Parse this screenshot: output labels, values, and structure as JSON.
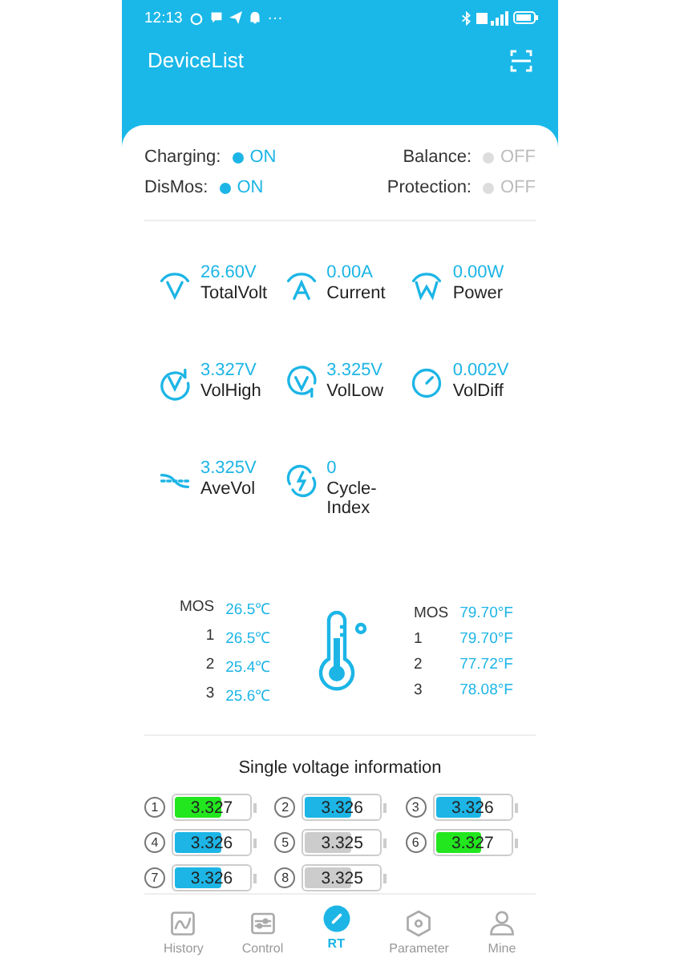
{
  "status_bar": {
    "time": "12:13",
    "more": "···"
  },
  "header": {
    "title": "DeviceList"
  },
  "switches": [
    {
      "label": "Charging:",
      "value": "ON",
      "on": true
    },
    {
      "label": "Balance:",
      "value": "OFF",
      "on": false
    },
    {
      "label": "DisMos:",
      "value": "ON",
      "on": true
    },
    {
      "label": "Protection:",
      "value": "OFF",
      "on": false
    }
  ],
  "metrics": [
    {
      "value": "26.60V",
      "label": "TotalVolt"
    },
    {
      "value": "0.00A",
      "label": "Current"
    },
    {
      "value": "0.00W",
      "label": "Power"
    },
    {
      "value": "3.327V",
      "label": "VolHigh"
    },
    {
      "value": "3.325V",
      "label": "VolLow"
    },
    {
      "value": "0.002V",
      "label": "VolDiff"
    },
    {
      "value": "3.325V",
      "label": "AveVol"
    },
    {
      "value": "0",
      "label": "Cycle-Index"
    }
  ],
  "temperatures_c": [
    {
      "name": "MOS",
      "value": "26.5℃"
    },
    {
      "name": "1",
      "value": "26.5℃"
    },
    {
      "name": "2",
      "value": "25.4℃"
    },
    {
      "name": "3",
      "value": "25.6℃"
    }
  ],
  "temperatures_f": [
    {
      "name": "MOS",
      "value": "79.70°F"
    },
    {
      "name": "1",
      "value": "79.70°F"
    },
    {
      "name": "2",
      "value": "77.72°F"
    },
    {
      "name": "3",
      "value": "78.08°F"
    }
  ],
  "cells_title": "Single voltage information",
  "cells": [
    {
      "index": "1",
      "value": "3.327",
      "level": 0.6,
      "color": "#22e61e"
    },
    {
      "index": "2",
      "value": "3.326",
      "level": 0.6,
      "color": "#1cb5e6"
    },
    {
      "index": "3",
      "value": "3.326",
      "level": 0.6,
      "color": "#1cb5e6"
    },
    {
      "index": "4",
      "value": "3.326",
      "level": 0.6,
      "color": "#1cb5e6"
    },
    {
      "index": "5",
      "value": "3.325",
      "level": 0.6,
      "color": "#cccccc"
    },
    {
      "index": "6",
      "value": "3.327",
      "level": 0.6,
      "color": "#22e61e"
    },
    {
      "index": "7",
      "value": "3.326",
      "level": 0.6,
      "color": "#1cb5e6"
    },
    {
      "index": "8",
      "value": "3.325",
      "level": 0.6,
      "color": "#cccccc"
    }
  ],
  "tabs": [
    {
      "label": "History",
      "selected": false
    },
    {
      "label": "Control",
      "selected": false
    },
    {
      "label": "RT",
      "selected": true
    },
    {
      "label": "Parameter",
      "selected": false
    },
    {
      "label": "Mine",
      "selected": false
    }
  ]
}
